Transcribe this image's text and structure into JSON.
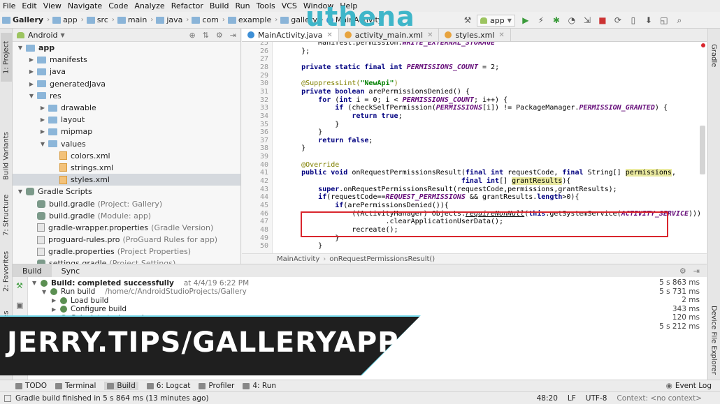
{
  "menu": [
    "File",
    "Edit",
    "View",
    "Navigate",
    "Code",
    "Analyze",
    "Refactor",
    "Build",
    "Run",
    "Tools",
    "VCS",
    "Window",
    "Help"
  ],
  "breadcrumbs": [
    "Gallery",
    "app",
    "src",
    "main",
    "java",
    "com",
    "example",
    "gallery",
    "MainActivity"
  ],
  "run_config": "app",
  "logo_text": "uthena",
  "project_panel": {
    "view_mode": "Android",
    "items": [
      {
        "label": "app",
        "depth": 0,
        "icon": "folder",
        "expanded": true
      },
      {
        "label": "manifests",
        "depth": 1,
        "icon": "folder"
      },
      {
        "label": "java",
        "depth": 1,
        "icon": "folder"
      },
      {
        "label": "generatedJava",
        "depth": 1,
        "icon": "folder"
      },
      {
        "label": "res",
        "depth": 1,
        "icon": "folder",
        "expanded": true
      },
      {
        "label": "drawable",
        "depth": 2,
        "icon": "folder"
      },
      {
        "label": "layout",
        "depth": 2,
        "icon": "folder"
      },
      {
        "label": "mipmap",
        "depth": 2,
        "icon": "folder"
      },
      {
        "label": "values",
        "depth": 2,
        "icon": "folder",
        "expanded": true
      },
      {
        "label": "colors.xml",
        "depth": 3,
        "icon": "xml"
      },
      {
        "label": "strings.xml",
        "depth": 3,
        "icon": "xml"
      },
      {
        "label": "styles.xml",
        "depth": 3,
        "icon": "xml",
        "selected": true
      },
      {
        "label": "Gradle Scripts",
        "depth": 0,
        "icon": "gradle",
        "expanded": true
      },
      {
        "label": "build.gradle",
        "note": "(Project: Gallery)",
        "depth": 1,
        "icon": "gradle"
      },
      {
        "label": "build.gradle",
        "note": "(Module: app)",
        "depth": 1,
        "icon": "gradle"
      },
      {
        "label": "gradle-wrapper.properties",
        "note": "(Gradle Version)",
        "depth": 1,
        "icon": "props"
      },
      {
        "label": "proguard-rules.pro",
        "note": "(ProGuard Rules for app)",
        "depth": 1,
        "icon": "props"
      },
      {
        "label": "gradle.properties",
        "note": "(Project Properties)",
        "depth": 1,
        "icon": "props"
      },
      {
        "label": "settings.gradle",
        "note": "(Project Settings)",
        "depth": 1,
        "icon": "gradle"
      }
    ]
  },
  "editor_tabs": [
    {
      "label": "MainActivity.java",
      "active": true,
      "color": "#3d8fd6"
    },
    {
      "label": "activity_main.xml",
      "active": false,
      "color": "#e7a33e"
    },
    {
      "label": "styles.xml",
      "active": false,
      "color": "#e7a33e"
    }
  ],
  "code_lines": [
    {
      "n": "25",
      "html": "        Manifest.permission.<span class=\"cst\">WRITE_EXTERNAL_STORAGE</span>"
    },
    {
      "n": "26",
      "html": "    };"
    },
    {
      "n": "27",
      "html": ""
    },
    {
      "n": "28",
      "html": "    <span class=\"kw\">private static final int</span> <span class=\"cst\">PERMISSIONS_COUNT</span> = 2;"
    },
    {
      "n": "29",
      "html": ""
    },
    {
      "n": "30",
      "html": "    <span class=\"an\">@SuppressLint(</span><span class=\"st\">\"NewApi\"</span><span class=\"an\">)</span>"
    },
    {
      "n": "31",
      "html": "    <span class=\"kw\">private boolean</span> arePermissionsDenied() {"
    },
    {
      "n": "32",
      "html": "        <span class=\"kw\">for</span> (<span class=\"kw\">int</span> i = 0; i &lt; <span class=\"cst\">PERMISSIONS_COUNT</span>; i++) {"
    },
    {
      "n": "33",
      "html": "            <span class=\"kw\">if</span> (checkSelfPermission(<span class=\"cst\">PERMISSIONS</span>[i]) != PackageManager.<span class=\"cst\">PERMISSION_GRANTED</span>) {"
    },
    {
      "n": "34",
      "html": "                <span class=\"kw\">return true</span>;"
    },
    {
      "n": "35",
      "html": "            }"
    },
    {
      "n": "36",
      "html": "        }"
    },
    {
      "n": "37",
      "html": "        <span class=\"kw\">return false</span>;"
    },
    {
      "n": "38",
      "html": "    }"
    },
    {
      "n": "39",
      "html": ""
    },
    {
      "n": "40",
      "html": "    <span class=\"an\">@Override</span>"
    },
    {
      "n": "41",
      "html": "    <span class=\"kw\">public void</span> onRequestPermissionsResult(<span class=\"kw\">final int</span> requestCode, <span class=\"kw\">final</span> String[] <span class=\"hl\">permissions</span>,"
    },
    {
      "n": "42",
      "html": "                                          <span class=\"kw\">final int</span>[] <span class=\"hl\">grantResults</span>){"
    },
    {
      "n": "43",
      "html": "        <span class=\"kw\">super</span>.onRequestPermissionsResult(requestCode,permissions,grantResults);"
    },
    {
      "n": "44",
      "html": "        <span class=\"kw\">if</span>(requestCode==<span class=\"cst\">REQUEST_PERMISSIONS</span> &amp;&amp; grantResults.<span class=\"kw\">length</span>&gt;0){"
    },
    {
      "n": "45",
      "html": "            <span class=\"kw\">if</span>(arePermissionsDenied()){"
    },
    {
      "n": "46",
      "html": "                ((ActivityManager) Objects.<span class=\"fn\"><u>requireNonNull</u></span>(<span class=\"kw\">this</span>.getSystemService(<span class=\"cst\">ACTIVITY_SERVICE</span>)))"
    },
    {
      "n": "47",
      "html": "                        .clearApplicationUserData();"
    },
    {
      "n": "48",
      "html": "                recreate();"
    },
    {
      "n": "49",
      "html": "            }"
    },
    {
      "n": "50",
      "html": "        }"
    }
  ],
  "editor_breadcrumb": [
    "MainActivity",
    "onRequestPermissionsResult()"
  ],
  "build_tabs": [
    "Build",
    "Sync"
  ],
  "build_rows": [
    {
      "label": "Build:",
      "strong": "Build: completed successfully",
      "note": "at 4/4/19 6:22 PM",
      "time": "5 s 863 ms",
      "depth": 0
    },
    {
      "label": "Run build",
      "note": "/home/c/AndroidStudioProjects/Gallery",
      "time": "5 s 731 ms",
      "depth": 1
    },
    {
      "label": "Load build",
      "time": "2 ms",
      "depth": 2
    },
    {
      "label": "Configure build",
      "time": "343 ms",
      "depth": 2
    },
    {
      "label": "Calculate task graph",
      "time": "120 ms",
      "depth": 2
    },
    {
      "label": "",
      "time": "5 s 212 ms",
      "depth": 2
    }
  ],
  "banner_text": "JERRY.TIPS/GALLERYAPP",
  "bottom_tabs": [
    "TODO",
    "Terminal",
    "Build",
    "6: Logcat",
    "Profiler",
    "4: Run"
  ],
  "event_log": "Event Log",
  "status": {
    "message": "Gradle build finished in 5 s 864 ms (13 minutes ago)",
    "position": "48:20",
    "line_sep": "LF",
    "encoding": "UTF-8",
    "context": "Context: <no context>"
  },
  "left_strip": [
    "1: Project",
    "Build Variants",
    "7: Structure",
    "2: Favorites",
    "ures"
  ],
  "right_strip": [
    "Gradle",
    "Device File Explorer"
  ]
}
